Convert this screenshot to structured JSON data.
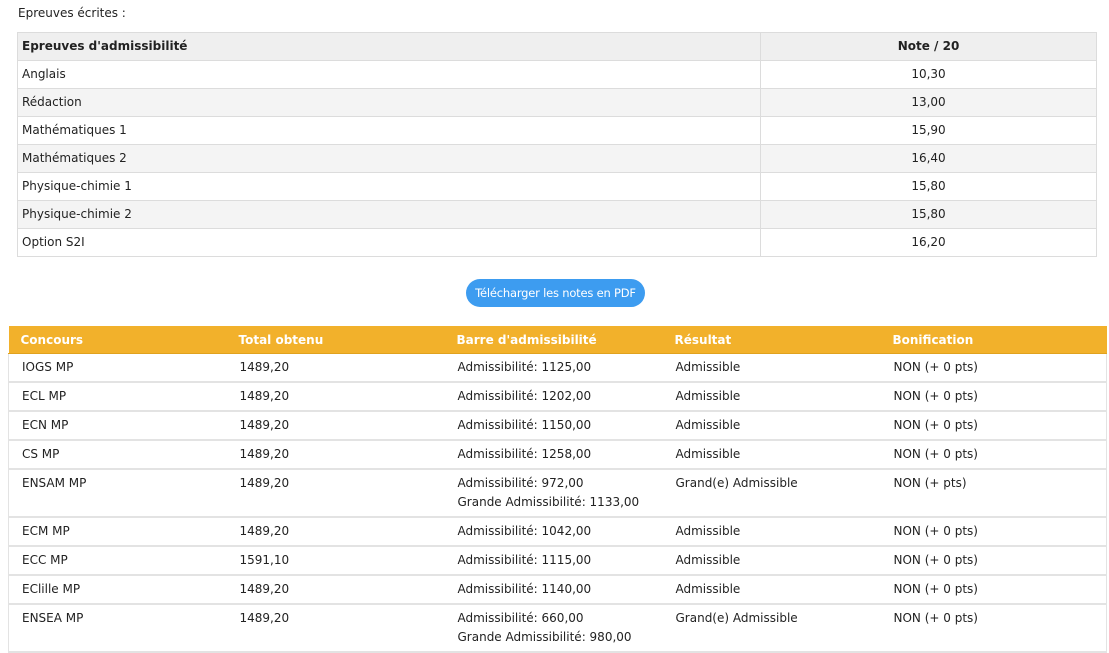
{
  "section_title": "Epreuves écrites :",
  "grades_table": {
    "headers": [
      "Epreuves d'admissibilité",
      "Note / 20"
    ],
    "rows": [
      {
        "subject": "Anglais",
        "grade": "10,30"
      },
      {
        "subject": "Rédaction",
        "grade": "13,00"
      },
      {
        "subject": "Mathématiques 1",
        "grade": "15,90"
      },
      {
        "subject": "Mathématiques 2",
        "grade": "16,40"
      },
      {
        "subject": "Physique-chimie 1",
        "grade": "15,80"
      },
      {
        "subject": "Physique-chimie 2",
        "grade": "15,80"
      },
      {
        "subject": "Option S2I",
        "grade": "16,20"
      }
    ]
  },
  "download_button": {
    "label": "Télécharger les notes en PDF"
  },
  "results_table": {
    "headers": [
      "Concours",
      "Total obtenu",
      "Barre d'admissibilité",
      "Résultat",
      "Bonification"
    ],
    "rows": [
      {
        "concours": "IOGS MP",
        "total": "1489,20",
        "barre": "Admissibilité: 1125,00",
        "barre2": "",
        "resultat": "Admissible",
        "bonification": "NON (+ 0 pts)"
      },
      {
        "concours": "ECL MP",
        "total": "1489,20",
        "barre": "Admissibilité: 1202,00",
        "barre2": "",
        "resultat": "Admissible",
        "bonification": "NON (+ 0 pts)"
      },
      {
        "concours": "ECN MP",
        "total": "1489,20",
        "barre": "Admissibilité: 1150,00",
        "barre2": "",
        "resultat": "Admissible",
        "bonification": "NON (+ 0 pts)"
      },
      {
        "concours": "CS MP",
        "total": "1489,20",
        "barre": "Admissibilité: 1258,00",
        "barre2": "",
        "resultat": "Admissible",
        "bonification": "NON (+ 0 pts)"
      },
      {
        "concours": "ENSAM MP",
        "total": "1489,20",
        "barre": "Admissibilité: 972,00",
        "barre2": "Grande Admissibilité: 1133,00",
        "resultat": "Grand(e) Admissible",
        "bonification": "NON (+ pts)"
      },
      {
        "concours": "ECM MP",
        "total": "1489,20",
        "barre": "Admissibilité: 1042,00",
        "barre2": "",
        "resultat": "Admissible",
        "bonification": "NON (+ 0 pts)"
      },
      {
        "concours": "ECC MP",
        "total": "1591,10",
        "barre": "Admissibilité: 1115,00",
        "barre2": "",
        "resultat": "Admissible",
        "bonification": "NON (+ 0 pts)"
      },
      {
        "concours": "EClille MP",
        "total": "1489,20",
        "barre": "Admissibilité: 1140,00",
        "barre2": "",
        "resultat": "Admissible",
        "bonification": "NON (+ 0 pts)"
      },
      {
        "concours": "ENSEA MP",
        "total": "1489,20",
        "barre": "Admissibilité: 660,00",
        "barre2": "Grande Admissibilité: 980,00",
        "resultat": "Grand(e) Admissible",
        "bonification": "NON (+ 0 pts)"
      }
    ]
  },
  "colors": {
    "header_orange": "#f2b12b",
    "button_blue": "#3d9cf0"
  }
}
